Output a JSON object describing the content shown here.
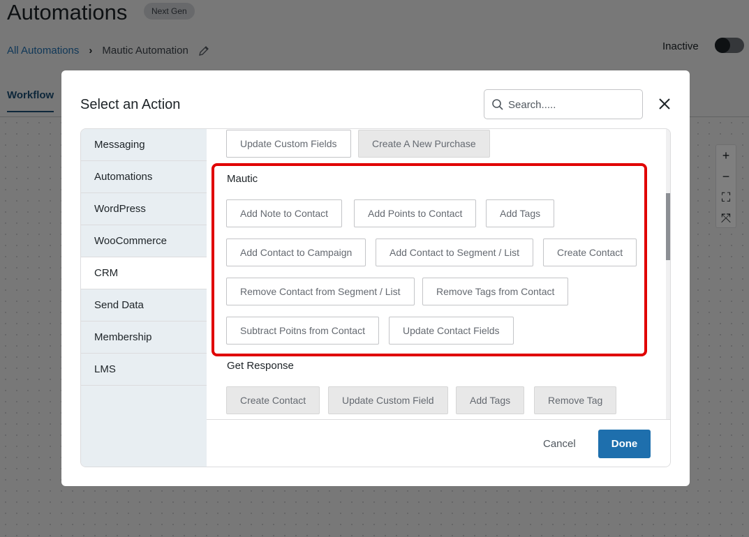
{
  "header": {
    "title": "Automations",
    "badge": "Next Gen",
    "breadcrumb": {
      "root": "All Automations",
      "current": "Mautic Automation"
    },
    "status_label": "Inactive"
  },
  "tabs": {
    "workflow": "Workflow"
  },
  "zoom_controls": [
    "plus-icon",
    "minus-icon",
    "fit-icon",
    "fullscreen-icon"
  ],
  "modal": {
    "title": "Select an Action",
    "search_placeholder": "Search.....",
    "categories": [
      "Messaging",
      "Automations",
      "WordPress",
      "WooCommerce",
      "CRM",
      "Send Data",
      "Membership",
      "LMS"
    ],
    "active_category": "CRM",
    "top_actions": [
      "Update Custom Fields",
      "Create A New Purchase"
    ],
    "mautic": {
      "label": "Mautic",
      "actions": [
        "Add Note to Contact",
        "Add Points to Contact",
        "Add Tags",
        "Add Contact to Campaign",
        "Add Contact to Segment / List",
        "Create Contact",
        "Remove Contact from Segment / List",
        "Remove Tags from Contact",
        "Subtract Poitns from Contact",
        "Update Contact Fields"
      ]
    },
    "get_response": {
      "label": "Get Response",
      "actions": [
        "Create Contact",
        "Update Custom Field",
        "Add Tags",
        "Remove Tag"
      ]
    },
    "cancel_label": "Cancel",
    "done_label": "Done"
  },
  "colors": {
    "accent": "#1e6fad",
    "highlight": "#e00000"
  }
}
